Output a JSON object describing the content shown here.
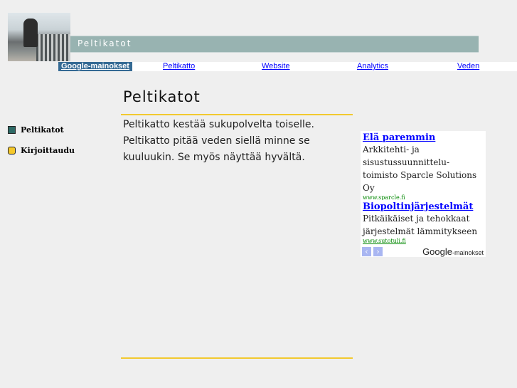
{
  "header": {
    "banner_title": "Peltikatot"
  },
  "nav": [
    {
      "label": "Google-mainokset",
      "selected": true
    },
    {
      "label": "Peltikatto"
    },
    {
      "label": "Website"
    },
    {
      "label": "Analytics"
    },
    {
      "label": "Veden"
    }
  ],
  "sidebar": [
    {
      "label": "Peltikatot",
      "icon": "square-teal-icon",
      "color": "#2e6a66"
    },
    {
      "label": "Kirjoittaudu",
      "icon": "square-yellow-icon",
      "color": "#f5c82a"
    }
  ],
  "main": {
    "title": "Peltikatot",
    "text": "Peltikatto kestää sukupolvelta toiselle. Peltikatto pitää veden siellä minne se kuuluukin. Se myös näyttää hyvältä."
  },
  "ads": {
    "items": [
      {
        "title": "Elä paremmin",
        "desc": "Arkkitehti- ja sisustussuunnittelu- toimisto Sparcle Solutions Oy",
        "url": "www.sparcle.fi"
      },
      {
        "title": "Biopoltinjärjestelmät",
        "desc": "Pitkäikäiset ja tehokkaat järjestelmät lämmitykseen",
        "url": "www.sutotuli.fi"
      }
    ],
    "brand": "Google",
    "brand_suffix": "-mainokset"
  },
  "colors": {
    "accent_line": "#f2c92f",
    "banner": "#98b3b1",
    "nav_selected": "#356a94"
  }
}
